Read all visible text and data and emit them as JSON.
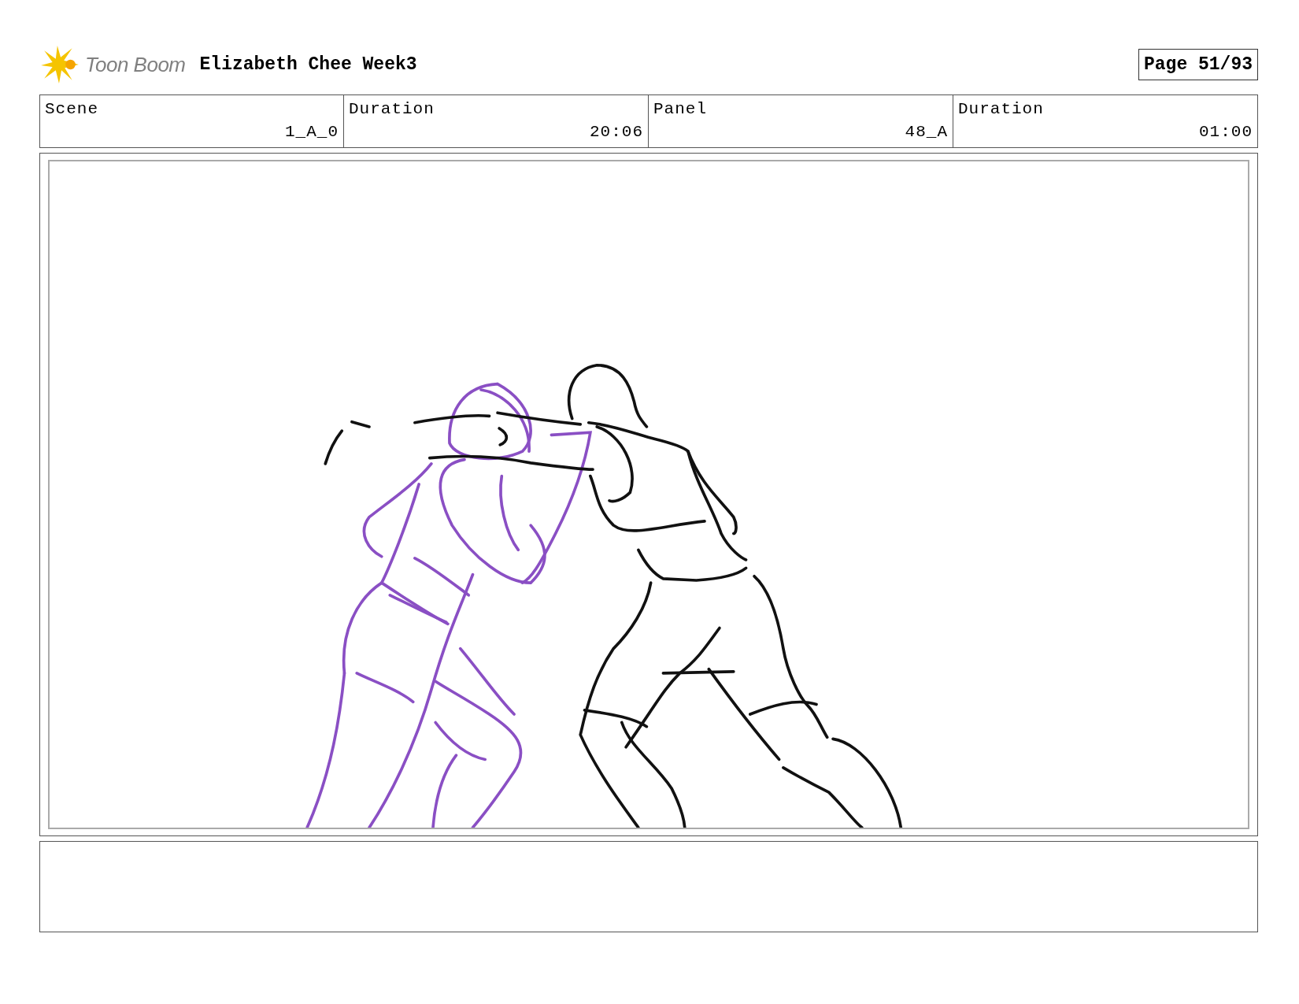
{
  "header": {
    "logo": "Toon Boom",
    "title": "Elizabeth Chee Week3",
    "page": "Page 51/93"
  },
  "info": {
    "columns": [
      "Scene",
      "Duration",
      "Panel",
      "Duration"
    ],
    "values": [
      "1_A_0",
      "20:06",
      "48_A",
      "01:00"
    ]
  }
}
